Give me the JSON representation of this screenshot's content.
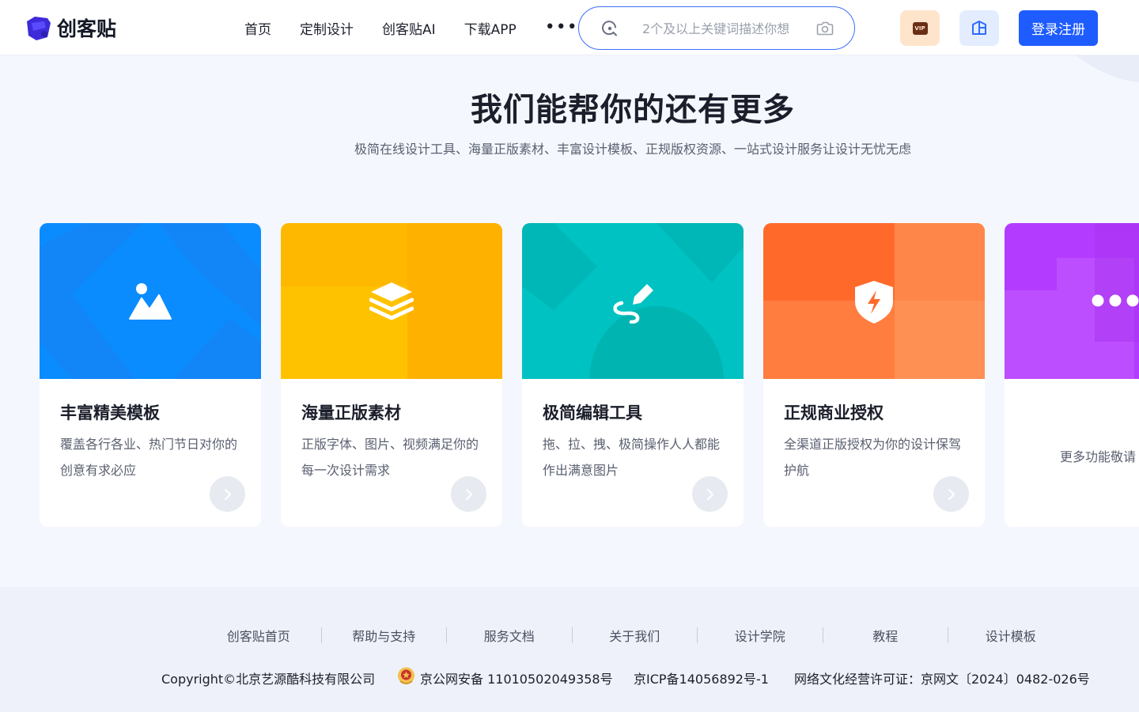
{
  "header": {
    "logo_text": "创客贴",
    "nav": [
      {
        "label": "首页"
      },
      {
        "label": "定制设计"
      },
      {
        "label": "创客贴AI"
      },
      {
        "label": "下载APP"
      }
    ],
    "more_label": "•••",
    "search": {
      "placeholder": "2个及以上关键词描述你想"
    },
    "vip_badge": "VIP",
    "login_label": "登录注册"
  },
  "section": {
    "title": "我们能帮你的还有更多",
    "subtitle": "极简在线设计工具、海量正版素材、丰富设计模板、正规版权资源、一站式设计服务让设计无忧无虑"
  },
  "cards": [
    {
      "title": "丰富精美模板",
      "desc": "覆盖各行各业、热门节日对你的创意有求必应",
      "icon": "image-icon",
      "color": "#0a8cff"
    },
    {
      "title": "海量正版素材",
      "desc": "正版字体、图片、视频满足你的每一次设计需求",
      "icon": "layers-icon",
      "color": "#ffb800"
    },
    {
      "title": "极简编辑工具",
      "desc": "拖、拉、拽、极简操作人人都能作出满意图片",
      "icon": "pen-icon",
      "color": "#00c2c2"
    },
    {
      "title": "正规商业授权",
      "desc": "全渠道正版授权为你的设计保驾护航",
      "icon": "shield-icon",
      "color": "#ff6a2b"
    },
    {
      "title": "",
      "desc": "更多功能敬请",
      "icon": "more-icon",
      "color": "#b33bff"
    }
  ],
  "footer": {
    "links": [
      "创客贴首页",
      "帮助与支持",
      "服务文档",
      "关于我们",
      "设计学院",
      "教程",
      "设计模板"
    ],
    "copyright": "Copyright©北京艺源酷科技有限公司",
    "police": "京公网安备 11010502049358号",
    "icp": "京ICP备14056892号-1",
    "license": "网络文化经营许可证：京网文〔2024〕0482-026号"
  }
}
